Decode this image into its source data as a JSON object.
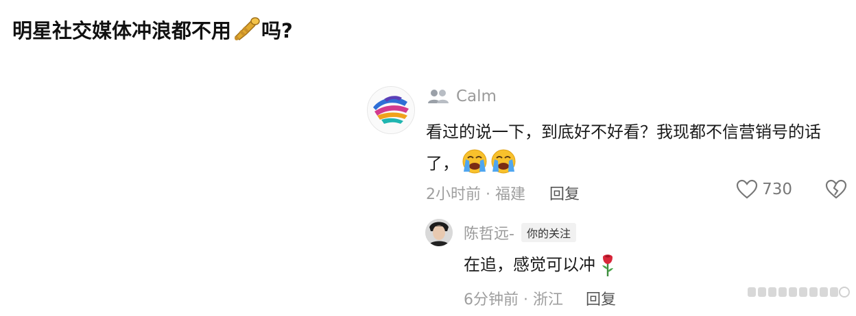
{
  "headline": {
    "text_before": "明星社交媒体冲浪都不用",
    "icon": "trumpet-icon",
    "text_after": "吗?"
  },
  "comment": {
    "username": "Calm",
    "user_icon": "users-icon",
    "body": "看过的说一下，到底好不好看？我现都不信营销号的话了，",
    "emoji": "loudly-crying-face-icon",
    "emoji_count": 2,
    "time": "2小时前",
    "separator": "·",
    "location": "福建",
    "reply_label": "回复",
    "like_count": "730"
  },
  "reply": {
    "username": "陈哲远-",
    "badge": "你的关注",
    "body": "在追，感觉可以冲",
    "emoji": "rose-icon",
    "time": "6分钟前",
    "separator": "·",
    "location": "浙江",
    "reply_label": "回复"
  },
  "colors": {
    "meta_gray": "#9e9e9e",
    "text": "#1a1a1a",
    "badge_bg": "#f1f1f1"
  }
}
